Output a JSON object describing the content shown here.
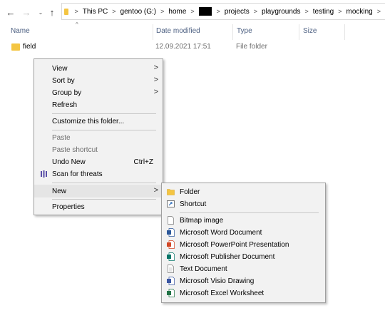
{
  "nav": {
    "back_icon": "←",
    "forward_icon": "→",
    "recent_icon": "⌄",
    "up_icon": "↑"
  },
  "breadcrumb": {
    "items": [
      "This PC",
      "gentoo (G:)",
      "home",
      "",
      "projects",
      "playgrounds",
      "testing",
      "mocking"
    ],
    "separator": ">"
  },
  "columns": {
    "name": "Name",
    "date_modified": "Date modified",
    "type": "Type",
    "size": "Size",
    "sort_indicator": "^"
  },
  "files": [
    {
      "name": "field",
      "date": "12.09.2021 17:51",
      "type": "File folder",
      "size": ""
    }
  ],
  "context_menu": {
    "items": [
      {
        "label": "View",
        "submenu_arrow": ">"
      },
      {
        "label": "Sort by",
        "submenu_arrow": ">"
      },
      {
        "label": "Group by",
        "submenu_arrow": ">"
      },
      {
        "label": "Refresh"
      },
      {
        "label": "Customize this folder..."
      },
      {
        "label": "Paste",
        "disabled": true
      },
      {
        "label": "Paste shortcut",
        "disabled": true
      },
      {
        "label": "Undo New",
        "shortcut": "Ctrl+Z"
      },
      {
        "label": "Scan for threats",
        "icon": "antivirus-icon"
      },
      {
        "label": "New",
        "submenu_arrow": ">",
        "highlighted": true
      },
      {
        "label": "Properties"
      }
    ]
  },
  "new_submenu": {
    "items": [
      {
        "label": "Folder",
        "icon": "folder-icon"
      },
      {
        "label": "Shortcut",
        "icon": "shortcut-icon"
      },
      {
        "label": "Bitmap image",
        "icon": "bitmap-icon"
      },
      {
        "label": "Microsoft Word Document",
        "icon": "word-icon"
      },
      {
        "label": "Microsoft PowerPoint Presentation",
        "icon": "powerpoint-icon"
      },
      {
        "label": "Microsoft Publisher Document",
        "icon": "publisher-icon"
      },
      {
        "label": "Text Document",
        "icon": "text-document-icon"
      },
      {
        "label": "Microsoft Visio Drawing",
        "icon": "visio-icon"
      },
      {
        "label": "Microsoft Excel Worksheet",
        "icon": "excel-icon"
      }
    ]
  },
  "colors": {
    "folder": "#f4c542",
    "column_header": "#4d6082",
    "menu_bg": "#f2f2f2",
    "menu_highlight": "#e5e5e5",
    "word": "#2b579a",
    "powerpoint": "#d24726",
    "publisher": "#077568",
    "visio": "#3955a3",
    "excel": "#217346"
  }
}
